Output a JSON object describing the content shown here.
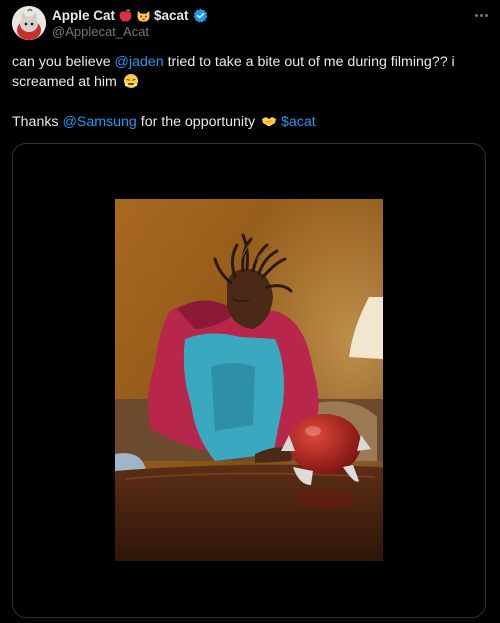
{
  "author": {
    "display_name": "Apple Cat",
    "cashtag_name": "$acat",
    "handle": "@Applecat_Acat",
    "name_emojis": [
      "red-apple-icon",
      "cat-face-icon"
    ],
    "verified": true
  },
  "tweet": {
    "line1_prefix": "can you believe ",
    "mention1": "@jaden",
    "line1_suffix": " tried to take a bite out of me during filming?? i screamed at him ",
    "line1_emoji": "steam-from-nose-face-icon",
    "line2_prefix": "Thanks ",
    "mention2": "@Samsung",
    "line2_middle": " for the opportunity ",
    "line2_emoji": "handshake-icon",
    "cashtag": "$acat"
  },
  "colors": {
    "background": "#000000",
    "text": "#e7e9ea",
    "secondary_text": "#71767b",
    "link": "#1d9bf0",
    "verified": "#1d9bf0",
    "border": "#2f3336"
  }
}
